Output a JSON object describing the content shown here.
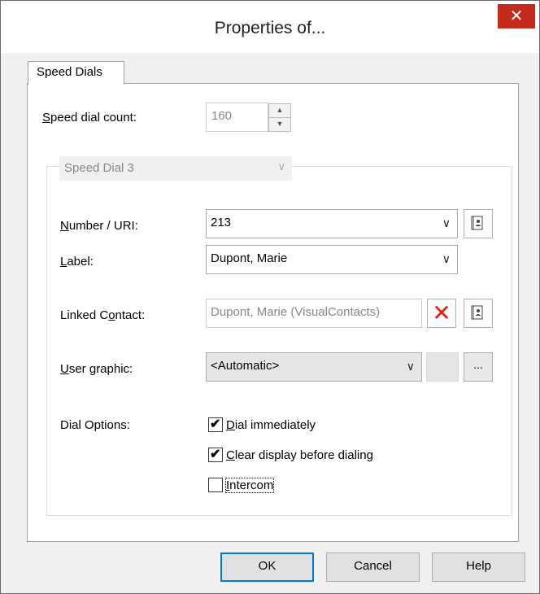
{
  "window": {
    "title": "Properties of...",
    "close_glyph": "✕"
  },
  "tabs": [
    {
      "label": "Speed Dials",
      "active": true
    }
  ],
  "speed_dial_count": {
    "label_pre": "",
    "label_key": "S",
    "label_post": "peed dial count:",
    "value": "160"
  },
  "group": {
    "selected": "Speed Dial 3"
  },
  "number_uri": {
    "label_pre": "",
    "label_key": "N",
    "label_post": "umber / URI:",
    "value": "213"
  },
  "label_field": {
    "label_pre": "",
    "label_key": "L",
    "label_post": "abel:",
    "value": "Dupont, Marie"
  },
  "linked_contact": {
    "label_pre": "Linked C",
    "label_key": "o",
    "label_post": "ntact:",
    "value": "Dupont, Marie (VisualContacts)"
  },
  "user_graphic": {
    "label_pre": "",
    "label_key": "U",
    "label_post": "ser graphic:",
    "value": "<Automatic>",
    "browse": "..."
  },
  "dial_options": {
    "label": "Dial Options:",
    "dial_immediately": {
      "label_key": "D",
      "label_post": "ial immediately",
      "checked": true
    },
    "clear_display": {
      "label_key": "C",
      "label_post": "lear display before dialing",
      "checked": true
    },
    "intercom": {
      "label_key": "I",
      "label_post": "ntercom",
      "checked": false
    }
  },
  "buttons": {
    "ok": "OK",
    "cancel": "Cancel",
    "help": "Help"
  },
  "icons": {
    "addressbook": "addressbook-icon",
    "remove": "remove-x-icon",
    "check": "✔"
  },
  "colors": {
    "close": "#c42b1c",
    "remove_x": "#e8200e",
    "default_button_border": "#0078d7"
  }
}
